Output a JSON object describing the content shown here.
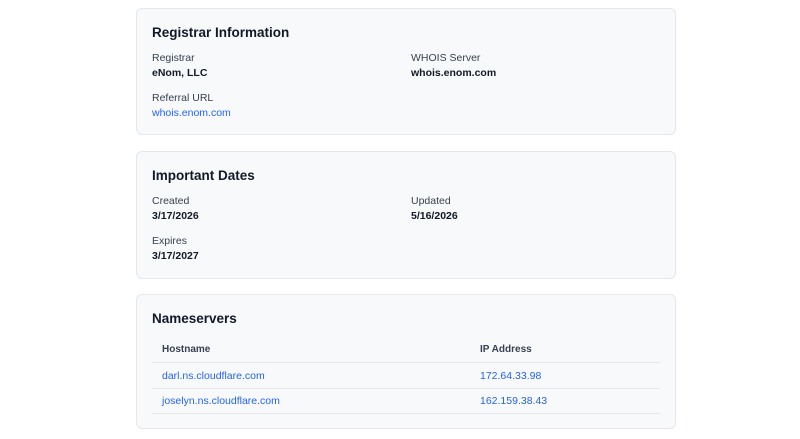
{
  "registrar": {
    "title": "Registrar Information",
    "registrar_label": "Registrar",
    "registrar_value": "eNom, LLC",
    "whois_label": "WHOIS Server",
    "whois_value": "whois.enom.com",
    "referral_label": "Referral URL",
    "referral_value": "whois.enom.com"
  },
  "dates": {
    "title": "Important Dates",
    "created_label": "Created",
    "created_value": "3/17/2026",
    "updated_label": "Updated",
    "updated_value": "5/16/2026",
    "expires_label": "Expires",
    "expires_value": "3/17/2027"
  },
  "nameservers": {
    "title": "Nameservers",
    "columns": [
      "Hostname",
      "IP Address"
    ],
    "rows": [
      {
        "hostname": "darl.ns.cloudflare.com",
        "ip": "172.64.33.98"
      },
      {
        "hostname": "joselyn.ns.cloudflare.com",
        "ip": "162.159.38.43"
      }
    ]
  }
}
